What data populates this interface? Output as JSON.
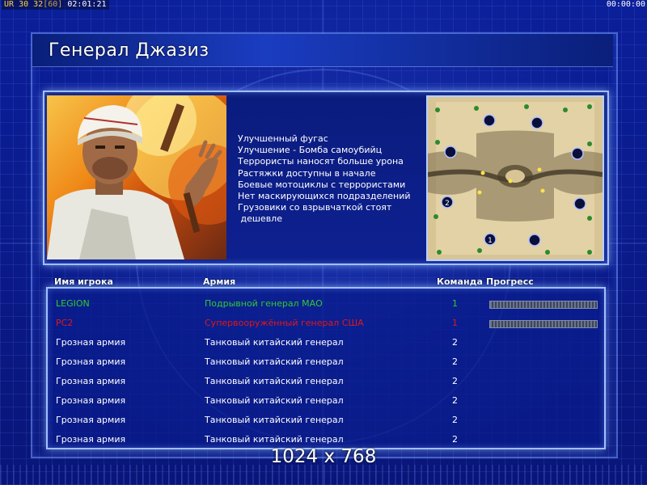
{
  "hud": {
    "prefix": "UR",
    "val1": "30",
    "val2": "32",
    "val3": "[60]",
    "time_left": "02:01:21",
    "time_right": "00:00:00"
  },
  "title": "Генерал Джазиз",
  "perks": [
    "Улучшенный фугас",
    "Улучшение - Бомба самоубийц",
    "Террористы наносят больше урона",
    "Растяжки доступны в начале",
    "Боевые мотоциклы с террористами",
    "Нет маскирующихся подразделений",
    "Грузовики со взрывчаткой стоят",
    " дешевле"
  ],
  "minimap": {
    "start_markers": [
      "1",
      "2"
    ]
  },
  "table": {
    "headers": {
      "player": "Имя игрока",
      "army": "Армия",
      "team": "Команда",
      "progress": "Прогресс"
    },
    "rows": [
      {
        "player": "LEGION",
        "army": "Подрывной генерал МАО",
        "team": "1",
        "color": "#2ecc2e",
        "progress": 1.0
      },
      {
        "player": "PC2",
        "army": "Супервооружённый генерал США",
        "team": "1",
        "color": "#e01818",
        "progress": 1.0
      },
      {
        "player": "Грозная армия",
        "army": "Танковый китайский генерал",
        "team": "2",
        "color": "#ffffff",
        "progress": null
      },
      {
        "player": "Грозная армия",
        "army": "Танковый китайский генерал",
        "team": "2",
        "color": "#ffffff",
        "progress": null
      },
      {
        "player": "Грозная армия",
        "army": "Танковый китайский генерал",
        "team": "2",
        "color": "#ffffff",
        "progress": null
      },
      {
        "player": "Грозная армия",
        "army": "Танковый китайский генерал",
        "team": "2",
        "color": "#ffffff",
        "progress": null
      },
      {
        "player": "Грозная армия",
        "army": "Танковый китайский генерал",
        "team": "2",
        "color": "#ffffff",
        "progress": null
      },
      {
        "player": "Грозная армия",
        "army": "Танковый китайский генерал",
        "team": "2",
        "color": "#ffffff",
        "progress": null
      }
    ]
  },
  "resolution": "1024 x 768"
}
